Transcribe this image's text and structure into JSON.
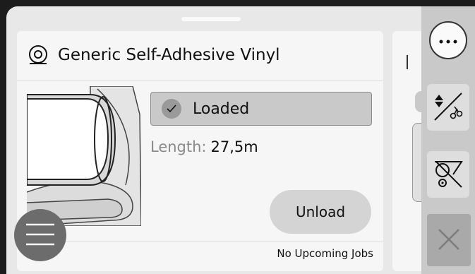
{
  "media_card": {
    "title": "Generic Self-Adhesive Vinyl",
    "status": "Loaded",
    "length_label": "Length:",
    "length_value": "27,5m",
    "unload_label": "Unload",
    "upcoming_jobs": "No Upcoming Jobs"
  },
  "icons": {
    "roll": "media-roll-icon",
    "check": "check-icon",
    "menu": "hamburger-menu-icon",
    "more": "more-options-icon",
    "cut": "feed-and-cut-icon",
    "no_cut": "disable-cutter-icon",
    "close": "close-icon"
  },
  "colors": {
    "panel_bg": "#e8e8e8",
    "card_bg": "#f6f6f6",
    "sidebar_bg": "#c9c9c9",
    "pill_bg": "#c9c9c9"
  }
}
